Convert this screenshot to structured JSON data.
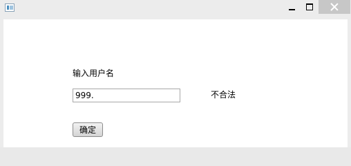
{
  "window": {
    "icon": "app-window-icon",
    "controls": {
      "minimize_icon": "minimize-icon",
      "maximize_icon": "maximize-icon",
      "close_icon": "close-icon"
    }
  },
  "form": {
    "username_label": "输入用户名",
    "username_value": "999.",
    "status_text": "不合法",
    "confirm_label": "确定"
  }
}
